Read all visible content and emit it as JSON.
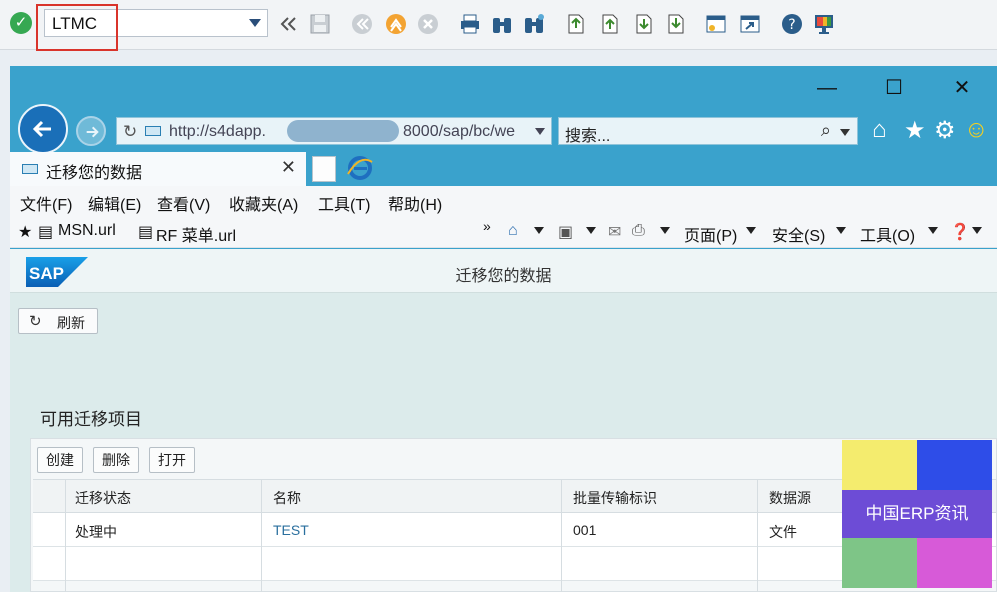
{
  "sap_toolbar": {
    "command_value": "LTMC"
  },
  "browser": {
    "window_controls": {
      "minimize": "—",
      "maximize": "☐",
      "close": "✕"
    },
    "address": {
      "url_start": "http://s4dapp.",
      "url_end": "8000/sap/bc/we"
    },
    "search_placeholder": "搜索...",
    "tab_title": "迁移您的数据",
    "menu": [
      "文件(F)",
      "编辑(E)",
      "查看(V)",
      "收藏夹(A)",
      "工具(T)",
      "帮助(H)"
    ],
    "favorites": [
      "MSN.url",
      "RF 菜单.url"
    ],
    "command_bar": {
      "page": "页面(P)",
      "safety": "安全(S)",
      "tools": "工具(O)"
    }
  },
  "page": {
    "logo_text": "SAP",
    "title": "迁移您的数据",
    "refresh_label": "刷新",
    "section_title": "可用迁移项目",
    "table": {
      "buttons": [
        "创建",
        "删除",
        "打开"
      ],
      "columns": [
        "迁移状态",
        "名称",
        "批量传输标识",
        "数据源"
      ],
      "rows": [
        {
          "status": "处理中",
          "name": "TEST",
          "mass_transfer_id": "001",
          "source": "文件"
        }
      ]
    }
  },
  "watermark": {
    "text": "中国ERP资讯",
    "colors": [
      "#f4ec6e",
      "#2e4de8",
      "#6d4cd6",
      "#7ec587",
      "#d75ad8"
    ]
  }
}
